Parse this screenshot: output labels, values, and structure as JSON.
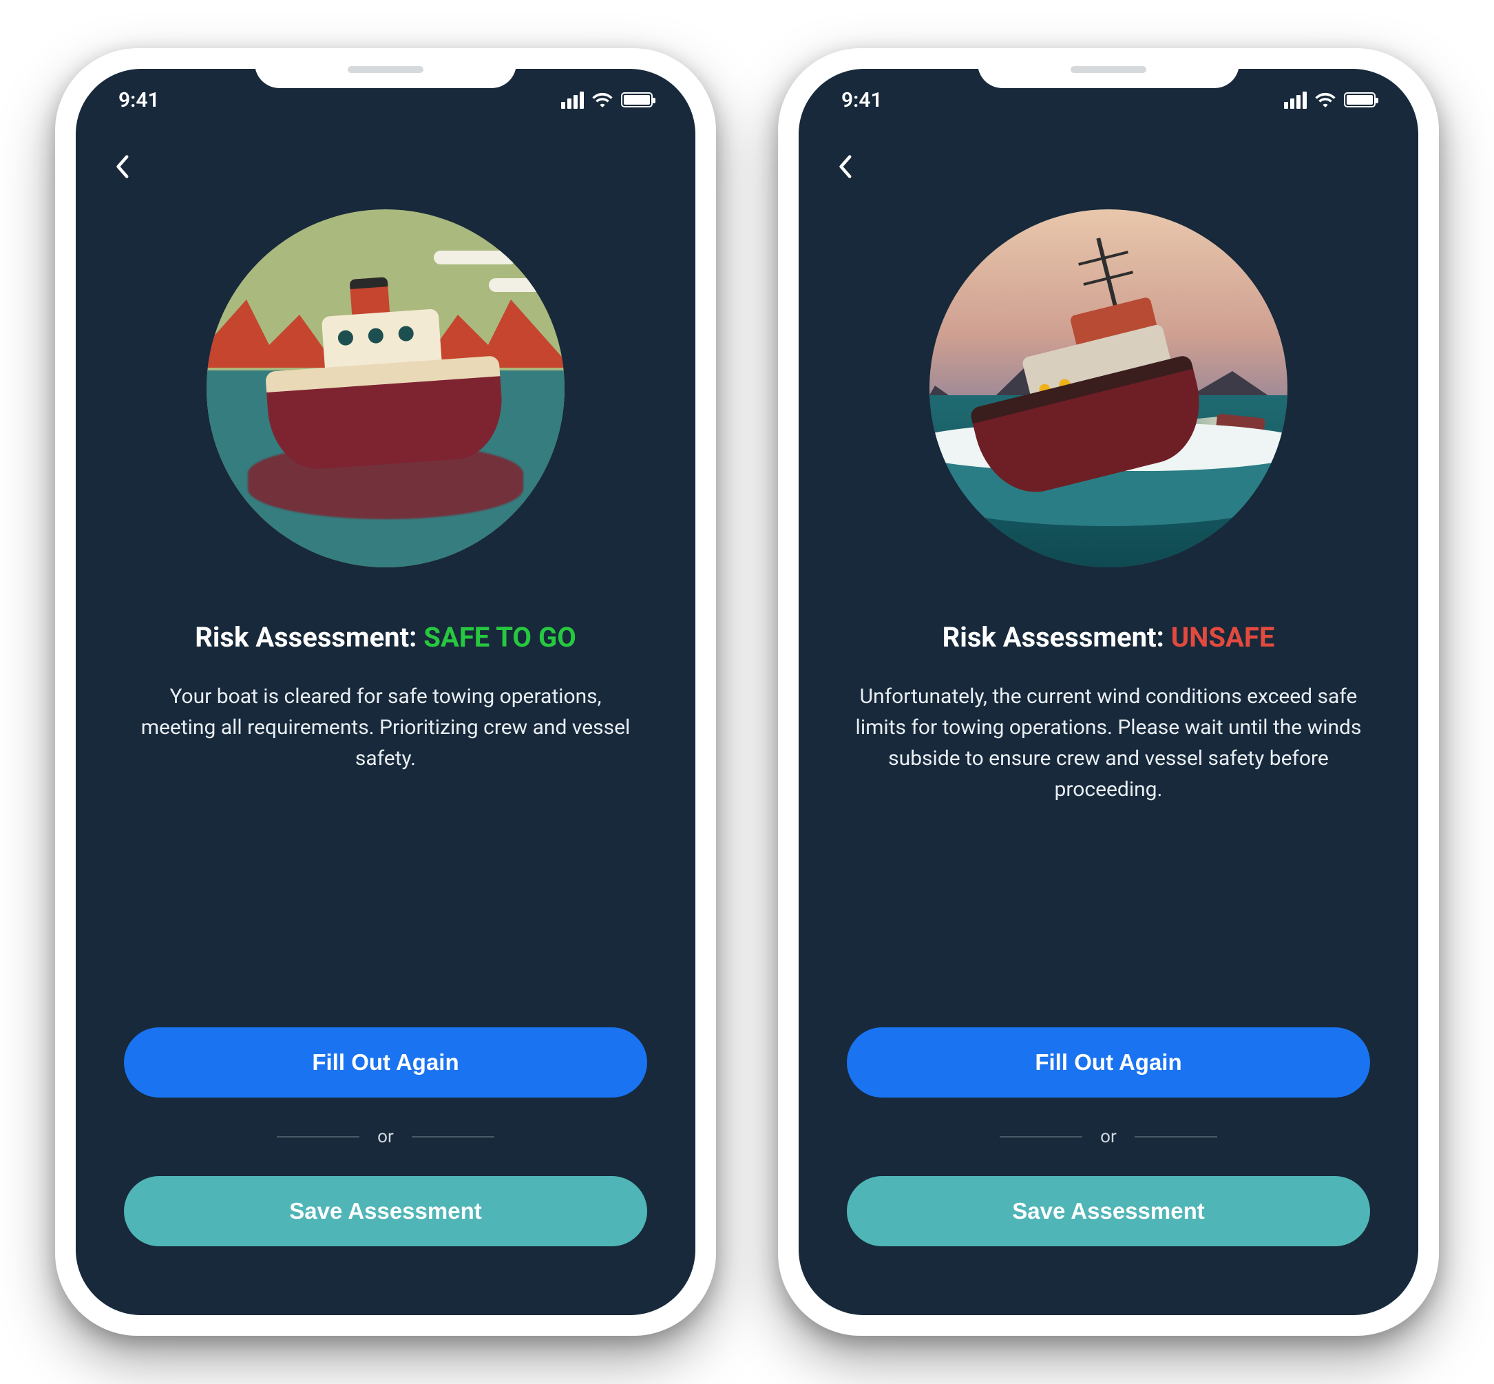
{
  "status_bar": {
    "time": "9:41"
  },
  "screens": {
    "safe": {
      "title_prefix": "Risk Assessment: ",
      "title_status": "SAFE TO GO",
      "body": "Your boat is cleared for safe towing operations, meeting all requirements. Prioritizing crew and vessel safety.",
      "primary_button": "Fill Out Again",
      "divider": "or",
      "secondary_button": "Save Assessment",
      "status_color": "#27c840",
      "illustration": "calm-boat"
    },
    "unsafe": {
      "title_prefix": "Risk Assessment: ",
      "title_status": "UNSAFE",
      "body": "Unfortunately, the current wind conditions exceed safe limits for towing operations. Please wait until the winds subside to ensure crew and vessel safety before proceeding.",
      "primary_button": "Fill Out Again",
      "divider": "or",
      "secondary_button": "Save Assessment",
      "status_color": "#e34a3e",
      "illustration": "storm-boat"
    }
  },
  "colors": {
    "screen_bg": "#17293a",
    "primary_button": "#1a73f0",
    "secondary_button": "#4fb5b7"
  }
}
